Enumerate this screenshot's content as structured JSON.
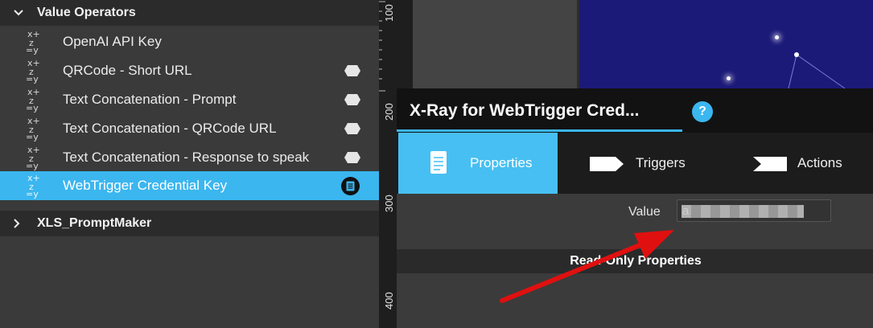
{
  "tree": {
    "groups": [
      {
        "label": "Value Operators",
        "expanded": true
      },
      {
        "label": "XLS_PromptMaker",
        "expanded": false
      }
    ],
    "items": [
      {
        "label": "OpenAI API Key",
        "badge": ""
      },
      {
        "label": "QRCode - Short URL",
        "badge": "tag-icon"
      },
      {
        "label": "Text Concatenation - Prompt",
        "badge": "tag-icon"
      },
      {
        "label": "Text Concatenation - QRCode URL",
        "badge": "tag-icon"
      },
      {
        "label": "Text Concatenation - Response to speak",
        "badge": "tag-icon"
      },
      {
        "label": "WebTrigger Credential Key",
        "badge": "document-icon",
        "selected": true
      }
    ],
    "operator_icon": {
      "glyph_top": "x+",
      "glyph_bottom": "=y",
      "glyph_mid": "z"
    }
  },
  "ruler": {
    "ticks": [
      "100",
      "200",
      "300",
      "400"
    ]
  },
  "xray": {
    "title": "X-Ray for WebTrigger Cred...",
    "help": "?",
    "tabs": [
      {
        "label": "Properties",
        "active": true
      },
      {
        "label": "Triggers",
        "active": false
      },
      {
        "label": "Actions",
        "active": false
      }
    ],
    "value_label": "Value",
    "value_text": "a",
    "read_only_header": "Read-Only Properties"
  },
  "colors": {
    "accent": "#3bb6ef",
    "panel": "#3a3a3a",
    "header": "#2b2b2b",
    "scene": "#1c1a78",
    "arrow": "#e01010"
  }
}
